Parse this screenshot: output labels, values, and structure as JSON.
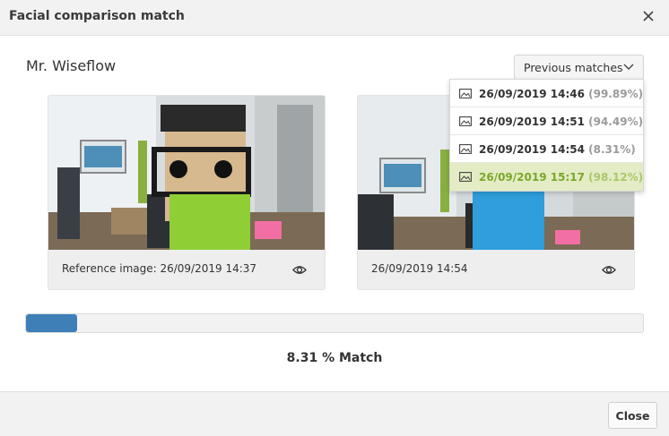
{
  "dialog": {
    "title": "Facial comparison match",
    "close_icon": "close-icon"
  },
  "person": {
    "name": "Mr. Wiseflow"
  },
  "previous_matches": {
    "label": "Previous matches",
    "items": [
      {
        "time": "26/09/2019 14:46",
        "percent": "(99.89%)",
        "active": false
      },
      {
        "time": "26/09/2019 14:51",
        "percent": "(94.49%)",
        "active": false
      },
      {
        "time": "26/09/2019 14:54",
        "percent": "(8.31%)",
        "active": false
      },
      {
        "time": "26/09/2019 15:17",
        "percent": "(98.12%)",
        "active": true
      }
    ]
  },
  "reference": {
    "caption": "Reference image: 26/09/2019 14:37"
  },
  "comparison": {
    "caption": "26/09/2019 14:54"
  },
  "match": {
    "value": 8.31,
    "label": "8.31 % Match"
  },
  "colors": {
    "progress": "#3e7fb8",
    "active_item_bg": "#e3ecc4",
    "active_item_text": "#7aa72a"
  },
  "footer": {
    "close_label": "Close"
  }
}
